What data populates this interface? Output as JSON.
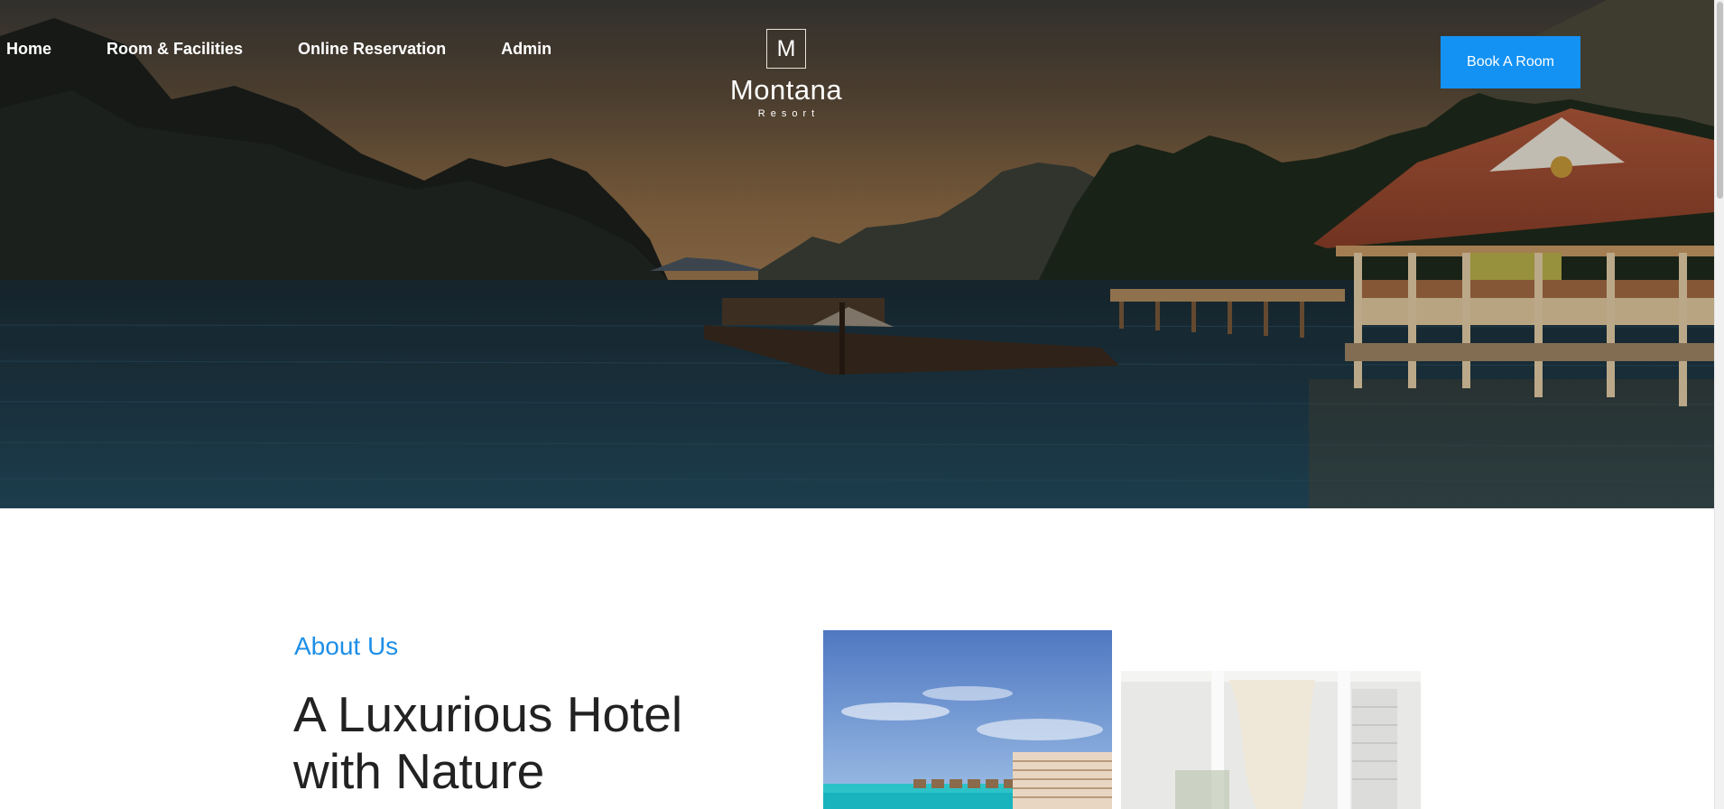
{
  "nav": {
    "items": [
      {
        "label": "Home"
      },
      {
        "label": "Room & Facilities"
      },
      {
        "label": "Online Reservation"
      },
      {
        "label": "Admin"
      }
    ]
  },
  "logo": {
    "mark": "M",
    "name": "Montana",
    "subtitle": "Resort"
  },
  "header": {
    "book_label": "Book A Room"
  },
  "about": {
    "kicker": "About Us",
    "title": "A Luxurious Hotel with Nature"
  },
  "colors": {
    "accent": "#1392f3",
    "kicker": "#1d8fe8",
    "heading": "#222222"
  }
}
